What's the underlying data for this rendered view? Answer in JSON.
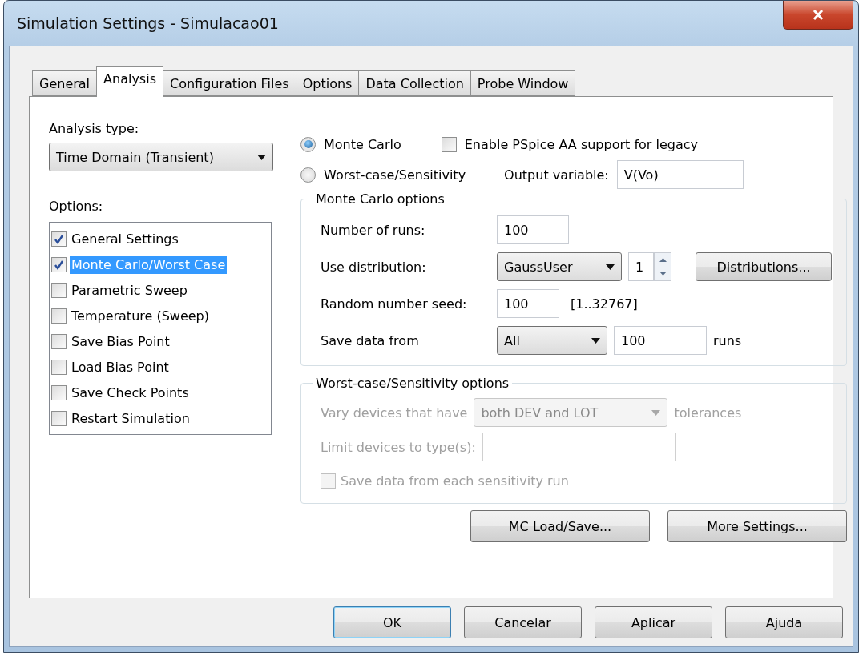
{
  "window": {
    "title": "Simulation Settings - Simulacao01"
  },
  "tabs": [
    {
      "label": "General",
      "selected": false
    },
    {
      "label": "Analysis",
      "selected": true
    },
    {
      "label": "Configuration Files",
      "selected": false
    },
    {
      "label": "Options",
      "selected": false
    },
    {
      "label": "Data Collection",
      "selected": false
    },
    {
      "label": "Probe Window",
      "selected": false
    }
  ],
  "analysis_type": {
    "label": "Analysis type:",
    "value": "Time Domain (Transient)"
  },
  "options": {
    "label": "Options:",
    "items": [
      {
        "label": "General Settings",
        "checked": true,
        "selected": false
      },
      {
        "label": "Monte Carlo/Worst Case",
        "checked": true,
        "selected": true
      },
      {
        "label": "Parametric Sweep",
        "checked": false,
        "selected": false
      },
      {
        "label": "Temperature (Sweep)",
        "checked": false,
        "selected": false
      },
      {
        "label": "Save Bias Point",
        "checked": false,
        "selected": false
      },
      {
        "label": "Load Bias Point",
        "checked": false,
        "selected": false
      },
      {
        "label": "Save Check Points",
        "checked": false,
        "selected": false
      },
      {
        "label": "Restart Simulation",
        "checked": false,
        "selected": false
      }
    ]
  },
  "mode_radios": [
    {
      "label": "Monte Carlo",
      "selected": true
    },
    {
      "label": "Worst-case/Sensitivity",
      "selected": false
    }
  ],
  "legacy_checkbox": {
    "label": "Enable PSpice AA support for legacy",
    "checked": false
  },
  "output_variable": {
    "label": "Output variable:",
    "value": "V(Vo)"
  },
  "monte_carlo": {
    "title": "Monte Carlo options",
    "runs_label": "Number of runs:",
    "runs_value": "100",
    "distribution_label": "Use distribution:",
    "distribution_value": "GaussUser",
    "distribution_index": "1",
    "distributions_button": "Distributions...",
    "seed_label": "Random number seed:",
    "seed_value": "100",
    "seed_range": "[1..32767]",
    "save_label": "Save data from",
    "save_value": "All",
    "save_count": "100",
    "save_unit": "runs"
  },
  "worst_case": {
    "title": "Worst-case/Sensitivity options",
    "disabled": true,
    "vary_label": "Vary devices that have",
    "vary_value": "both DEV and LOT",
    "vary_unit": "tolerances",
    "limit_label": "Limit devices to type(s):",
    "save_each": {
      "label": "Save data from each sensitivity run",
      "checked": false
    }
  },
  "panel_buttons": [
    "MC Load/Save...",
    "More Settings..."
  ],
  "buttons": [
    {
      "label": "OK",
      "default": true
    },
    {
      "label": "Cancelar",
      "default": false
    },
    {
      "label": "Aplicar",
      "default": false
    },
    {
      "label": "Ajuda",
      "default": false
    }
  ]
}
